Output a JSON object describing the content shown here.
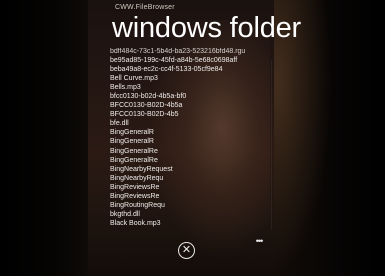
{
  "app": {
    "title": "CWW.FileBrowser"
  },
  "page": {
    "title": "windows folder"
  },
  "files": [
    {
      "name": "bdff484c-73c1-5b4d-ba23-523216bfd48.rgu"
    },
    {
      "name": "be95ad85-199c-45fd-a84b-5e68c0698aff"
    },
    {
      "name": "beba49a8-ec2c-cc4f-5133-05cf9e84"
    },
    {
      "name": "Bell Curve.mp3"
    },
    {
      "name": "Bells.mp3"
    },
    {
      "name": "bfcc0130-b02d-4b5a-bf0"
    },
    {
      "name": "BFCC0130-B02D-4b5a"
    },
    {
      "name": "BFCC0130-B02D-4b5"
    },
    {
      "name": "bfe.dll"
    },
    {
      "name": "BingGeneralR"
    },
    {
      "name": "BingGeneralR"
    },
    {
      "name": "BingGeneralRe"
    },
    {
      "name": "BingGeneralRe"
    },
    {
      "name": "BingNearbyRequest"
    },
    {
      "name": "BingNearbyRequ"
    },
    {
      "name": "BingReviewsRe"
    },
    {
      "name": "BingReviewsRe"
    },
    {
      "name": "BingRoutingRequ"
    },
    {
      "name": "bkgthd.dll"
    },
    {
      "name": "Black Book.mp3"
    }
  ],
  "app_bar": {
    "close_glyph": "✕",
    "more_glyph": "•••"
  },
  "colors": {
    "text": "#ffffff",
    "background": "#000000"
  }
}
